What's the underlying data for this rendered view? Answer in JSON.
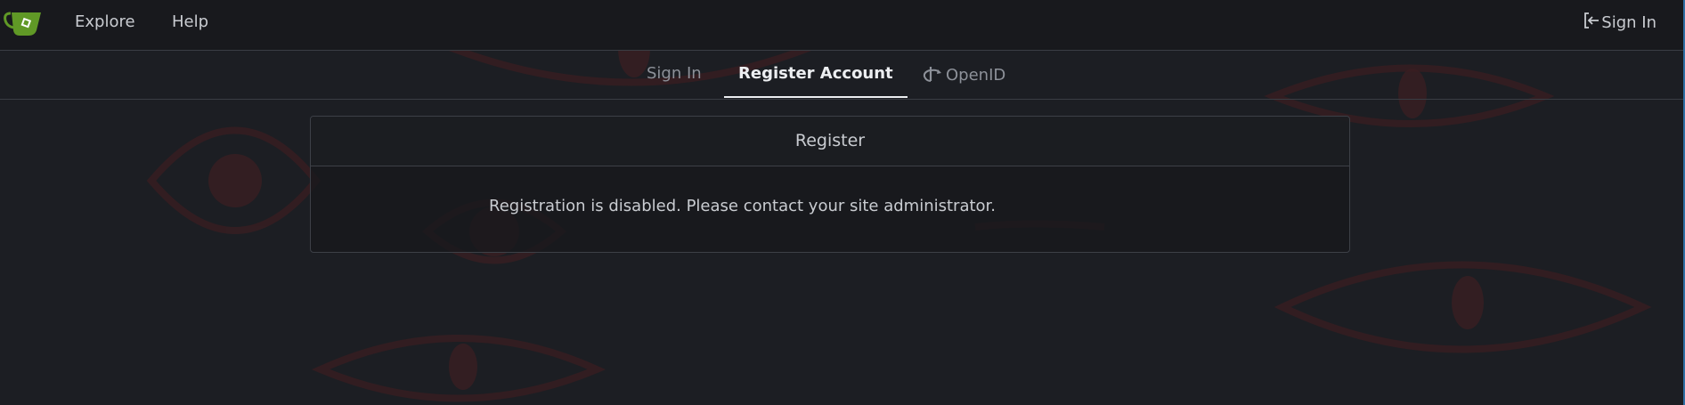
{
  "navbar": {
    "logo_icon": "gitea-logo-icon",
    "explore_label": "Explore",
    "help_label": "Help",
    "signin_label": "Sign In",
    "signin_icon": "sign-in-icon"
  },
  "tabs": {
    "signin_label": "Sign In",
    "register_label": "Register Account",
    "openid_label": "OpenID",
    "openid_icon": "openid-icon",
    "active": "Register Account"
  },
  "card": {
    "title": "Register",
    "message": "Registration is disabled. Please contact your site administrator."
  },
  "colors": {
    "background": "#1c1e23",
    "navbar": "#18191d",
    "accent_logo": "#609926",
    "eye_pattern": "#3a1e22"
  }
}
